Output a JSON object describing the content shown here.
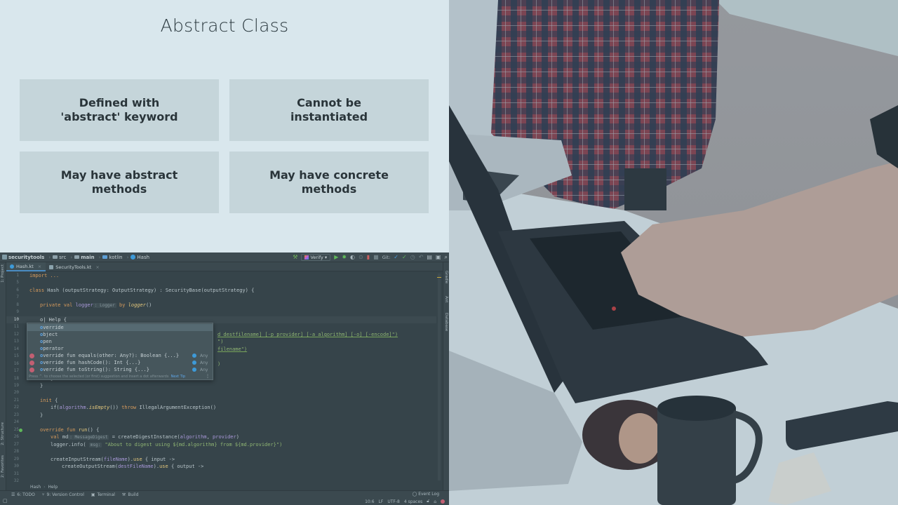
{
  "slide": {
    "title": "Abstract Class",
    "cards": [
      "Defined with 'abstract' keyword",
      "Cannot be instantiated",
      "May have abstract methods",
      "May have concrete methods"
    ]
  },
  "ide": {
    "breadcrumbs": [
      "securitytools",
      "src",
      "main",
      "kotlin",
      "Hash"
    ],
    "run_config": "Verify",
    "git_label": "Git:",
    "tabs": [
      {
        "label": "Hash.kt",
        "active": true
      },
      {
        "label": "SecurityTools.kt",
        "active": false
      }
    ],
    "left_tool_tabs": [
      "1: Project",
      "2: Structure",
      "2: Favorites"
    ],
    "right_tool_tabs": [
      "Gradle",
      "Ant",
      "Database"
    ],
    "line_numbers": [
      "1",
      "5",
      "6",
      "7",
      "8",
      "9",
      "10",
      "11",
      "12",
      "13",
      "14",
      "15",
      "16",
      "17",
      "18",
      "19",
      "20",
      "21",
      "22",
      "23",
      "24",
      "25",
      "26",
      "27",
      "28",
      "29",
      "30",
      "31",
      "32"
    ],
    "code": {
      "l1": "import ...",
      "l6_kw": "class",
      "l6": " Hash (outputStrategy: OutputStrategy) : SecurityBase(outputStrategy) {",
      "l8_kw": "private val ",
      "l8_prop": "logger",
      "l8_hint": ": Logger",
      "l8_by": " by ",
      "l8_fn": "logger",
      "l8_end": "()",
      "l10": "o| Help {",
      "l12_tail": "d destfilename] [-p provider] [-a algorithm] [-o] [-encode]\")",
      "l13_tail": "\")",
      "l14_tail": "filename\")",
      "l16_tail": ")",
      "l19": "}",
      "l20": "}",
      "l22_kw": "init",
      "l22": " {",
      "l23_a": "if(",
      "l23_prop": "algorithm",
      "l23_fn": "isEmpty",
      "l23_b": "()) ",
      "l23_kw": "throw",
      "l23_c": " IllegalArgumentException()",
      "l24": "}",
      "l26_kw": "override fun ",
      "l26_fn": "run",
      "l26": "() {",
      "l27_kw": "val ",
      "l27_a": "md",
      "l27_hint": ": MessageDigest",
      "l27_b": " = createDigestInstance(",
      "l27_p1": "algorithm",
      "l27_c": ", ",
      "l27_p2": "provider",
      "l27_d": ")",
      "l28_a": "logger.info( ",
      "l28_hint": "msg:",
      "l28_str": " \"About to digest using ${md.algorithm} from ${md.provider}\")",
      "l30_a": "createInputStream(",
      "l30_p": "fileName",
      "l30_b": ").",
      "l30_fn": "use",
      "l30_c": " { input ->",
      "l31_a": "createOutputStream(",
      "l31_p": "destFileName",
      "l31_b": ").",
      "l31_fn": "use",
      "l31_c": " { output ->"
    },
    "completion": {
      "items": [
        {
          "text": "override",
          "type": "",
          "icon": false
        },
        {
          "text": "object",
          "type": "",
          "icon": false
        },
        {
          "text": "open",
          "type": "",
          "icon": false
        },
        {
          "text": "operator",
          "type": "",
          "icon": false
        },
        {
          "text": "override fun equals(other: Any?): Boolean {...}",
          "type": "Any",
          "icon": true
        },
        {
          "text": "override fun hashCode(): Int {...}",
          "type": "Any",
          "icon": true
        },
        {
          "text": "override fun toString(): String {...}",
          "type": "Any",
          "icon": true
        }
      ],
      "tip": "Press ^. to choose the selected (or first) suggestion and insert a dot afterwards",
      "next_tip": "Next Tip"
    },
    "editor_breadcrumb": [
      "Hash",
      "Help"
    ],
    "bottom_tools": [
      "6: TODO",
      "9: Version Control",
      "Terminal",
      "Build"
    ],
    "event_log": "Event Log",
    "status": {
      "position": "10:6",
      "line_sep": "LF",
      "encoding": "UTF-8",
      "indent": "4 spaces"
    }
  },
  "photo": {
    "description": "Person typing on a laptop at a desk with coffee mug, donut and phone"
  }
}
